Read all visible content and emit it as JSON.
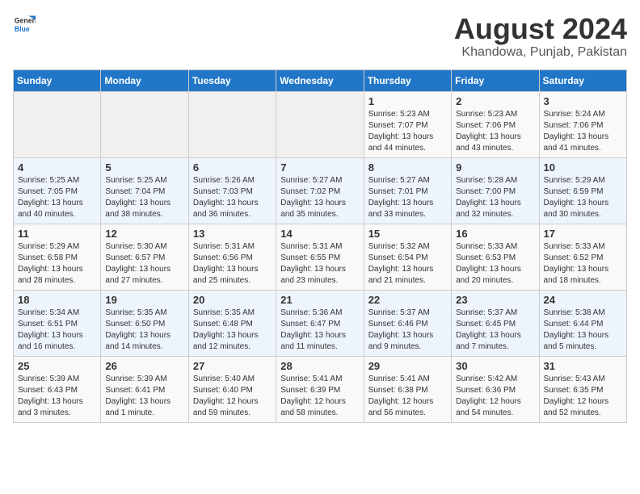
{
  "logo": {
    "general": "General",
    "blue": "Blue"
  },
  "title": "August 2024",
  "subtitle": "Khandowa, Punjab, Pakistan",
  "days_of_week": [
    "Sunday",
    "Monday",
    "Tuesday",
    "Wednesday",
    "Thursday",
    "Friday",
    "Saturday"
  ],
  "weeks": [
    [
      {
        "day": "",
        "info": ""
      },
      {
        "day": "",
        "info": ""
      },
      {
        "day": "",
        "info": ""
      },
      {
        "day": "",
        "info": ""
      },
      {
        "day": "1",
        "info": "Sunrise: 5:23 AM\nSunset: 7:07 PM\nDaylight: 13 hours\nand 44 minutes."
      },
      {
        "day": "2",
        "info": "Sunrise: 5:23 AM\nSunset: 7:06 PM\nDaylight: 13 hours\nand 43 minutes."
      },
      {
        "day": "3",
        "info": "Sunrise: 5:24 AM\nSunset: 7:06 PM\nDaylight: 13 hours\nand 41 minutes."
      }
    ],
    [
      {
        "day": "4",
        "info": "Sunrise: 5:25 AM\nSunset: 7:05 PM\nDaylight: 13 hours\nand 40 minutes."
      },
      {
        "day": "5",
        "info": "Sunrise: 5:25 AM\nSunset: 7:04 PM\nDaylight: 13 hours\nand 38 minutes."
      },
      {
        "day": "6",
        "info": "Sunrise: 5:26 AM\nSunset: 7:03 PM\nDaylight: 13 hours\nand 36 minutes."
      },
      {
        "day": "7",
        "info": "Sunrise: 5:27 AM\nSunset: 7:02 PM\nDaylight: 13 hours\nand 35 minutes."
      },
      {
        "day": "8",
        "info": "Sunrise: 5:27 AM\nSunset: 7:01 PM\nDaylight: 13 hours\nand 33 minutes."
      },
      {
        "day": "9",
        "info": "Sunrise: 5:28 AM\nSunset: 7:00 PM\nDaylight: 13 hours\nand 32 minutes."
      },
      {
        "day": "10",
        "info": "Sunrise: 5:29 AM\nSunset: 6:59 PM\nDaylight: 13 hours\nand 30 minutes."
      }
    ],
    [
      {
        "day": "11",
        "info": "Sunrise: 5:29 AM\nSunset: 6:58 PM\nDaylight: 13 hours\nand 28 minutes."
      },
      {
        "day": "12",
        "info": "Sunrise: 5:30 AM\nSunset: 6:57 PM\nDaylight: 13 hours\nand 27 minutes."
      },
      {
        "day": "13",
        "info": "Sunrise: 5:31 AM\nSunset: 6:56 PM\nDaylight: 13 hours\nand 25 minutes."
      },
      {
        "day": "14",
        "info": "Sunrise: 5:31 AM\nSunset: 6:55 PM\nDaylight: 13 hours\nand 23 minutes."
      },
      {
        "day": "15",
        "info": "Sunrise: 5:32 AM\nSunset: 6:54 PM\nDaylight: 13 hours\nand 21 minutes."
      },
      {
        "day": "16",
        "info": "Sunrise: 5:33 AM\nSunset: 6:53 PM\nDaylight: 13 hours\nand 20 minutes."
      },
      {
        "day": "17",
        "info": "Sunrise: 5:33 AM\nSunset: 6:52 PM\nDaylight: 13 hours\nand 18 minutes."
      }
    ],
    [
      {
        "day": "18",
        "info": "Sunrise: 5:34 AM\nSunset: 6:51 PM\nDaylight: 13 hours\nand 16 minutes."
      },
      {
        "day": "19",
        "info": "Sunrise: 5:35 AM\nSunset: 6:50 PM\nDaylight: 13 hours\nand 14 minutes."
      },
      {
        "day": "20",
        "info": "Sunrise: 5:35 AM\nSunset: 6:48 PM\nDaylight: 13 hours\nand 12 minutes."
      },
      {
        "day": "21",
        "info": "Sunrise: 5:36 AM\nSunset: 6:47 PM\nDaylight: 13 hours\nand 11 minutes."
      },
      {
        "day": "22",
        "info": "Sunrise: 5:37 AM\nSunset: 6:46 PM\nDaylight: 13 hours\nand 9 minutes."
      },
      {
        "day": "23",
        "info": "Sunrise: 5:37 AM\nSunset: 6:45 PM\nDaylight: 13 hours\nand 7 minutes."
      },
      {
        "day": "24",
        "info": "Sunrise: 5:38 AM\nSunset: 6:44 PM\nDaylight: 13 hours\nand 5 minutes."
      }
    ],
    [
      {
        "day": "25",
        "info": "Sunrise: 5:39 AM\nSunset: 6:43 PM\nDaylight: 13 hours\nand 3 minutes."
      },
      {
        "day": "26",
        "info": "Sunrise: 5:39 AM\nSunset: 6:41 PM\nDaylight: 13 hours\nand 1 minute."
      },
      {
        "day": "27",
        "info": "Sunrise: 5:40 AM\nSunset: 6:40 PM\nDaylight: 12 hours\nand 59 minutes."
      },
      {
        "day": "28",
        "info": "Sunrise: 5:41 AM\nSunset: 6:39 PM\nDaylight: 12 hours\nand 58 minutes."
      },
      {
        "day": "29",
        "info": "Sunrise: 5:41 AM\nSunset: 6:38 PM\nDaylight: 12 hours\nand 56 minutes."
      },
      {
        "day": "30",
        "info": "Sunrise: 5:42 AM\nSunset: 6:36 PM\nDaylight: 12 hours\nand 54 minutes."
      },
      {
        "day": "31",
        "info": "Sunrise: 5:43 AM\nSunset: 6:35 PM\nDaylight: 12 hours\nand 52 minutes."
      }
    ]
  ]
}
